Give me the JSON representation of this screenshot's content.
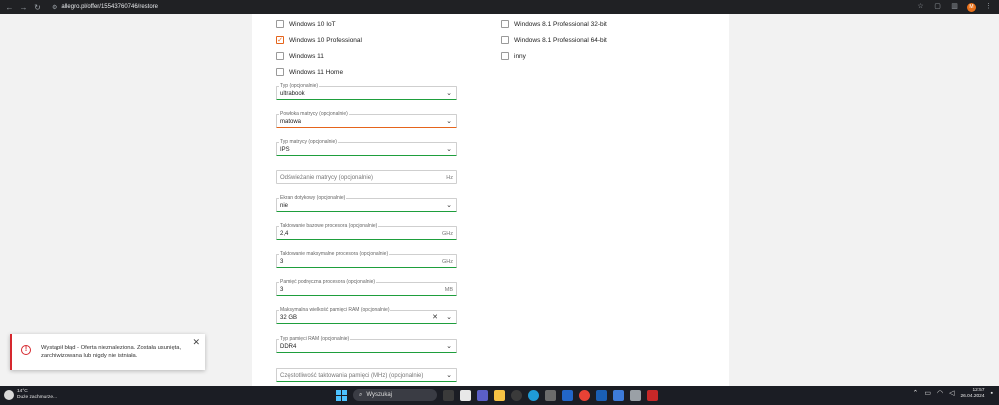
{
  "browser": {
    "url": "allegro.pl/offer/15543760746/restore",
    "profile_initial": "M",
    "icons": [
      "back-icon",
      "forward-icon",
      "reload-icon",
      "star-icon",
      "extensions-icon",
      "sidebar-icon",
      "menu-icon"
    ]
  },
  "checkboxes_left": [
    {
      "label": "Windows 10 IoT",
      "checked": false
    },
    {
      "label": "Windows 10 Professional",
      "checked": true
    },
    {
      "label": "Windows 11",
      "checked": false
    },
    {
      "label": "Windows 11 Home",
      "checked": false
    }
  ],
  "checkboxes_right": [
    {
      "label": "Windows 8.1 Professional 32-bit",
      "checked": false
    },
    {
      "label": "Windows 8.1 Professional 64-bit",
      "checked": false
    },
    {
      "label": "inny",
      "checked": false
    }
  ],
  "fields": {
    "typ": {
      "label": "Typ (opcjonalnie)",
      "value": "ultrabook"
    },
    "powloka": {
      "label": "Powłoka matrycy (opcjonalnie)",
      "value": "matowa"
    },
    "typ_matrycy": {
      "label": "Typ matrycy (opcjonalnie)",
      "value": "IPS"
    },
    "odswiezanie": {
      "placeholder": "Odświeżanie matrycy (opcjonalnie)",
      "unit": "Hz"
    },
    "ekran": {
      "label": "Ekran dotykowy (opcjonalnie)",
      "value": "nie"
    },
    "taktowanie_bazowe": {
      "label": "Taktowanie bazowe procesora (opcjonalnie)",
      "value": "2,4",
      "unit": "GHz"
    },
    "taktowanie_max": {
      "label": "Taktowanie maksymalne procesora (opcjonalnie)",
      "value": "3",
      "unit": "GHz"
    },
    "pamiec_podreczna": {
      "label": "Pamięć podręczna procesora (opcjonalnie)",
      "value": "3",
      "unit": "MB"
    },
    "max_ram": {
      "label": "Maksymalna wielkość pamięci RAM (opcjonalnie)",
      "value": "32 GB"
    },
    "typ_ram": {
      "label": "Typ pamięci RAM (opcjonalnie)",
      "value": "DDR4"
    },
    "czestotliwosc": {
      "placeholder": "Częstotliwość taktowania pamięci (MHz) (opcjonalnie)"
    }
  },
  "toast": {
    "message": "Wystąpił błąd - Oferta nieznaleziona. Została usunięta, zarchiwizowana lub nigdy nie istniała.",
    "icon": "error-icon"
  },
  "taskbar": {
    "weather_temp": "14°C",
    "weather_desc": "Duże zachmurze...",
    "search_label": "Wyszukaj",
    "time": "12:57",
    "date": "26.04.2024"
  },
  "colors": {
    "accent_orange": "#e5641b",
    "valid_green": "#1e9e3c",
    "error_red": "#d6282e"
  }
}
